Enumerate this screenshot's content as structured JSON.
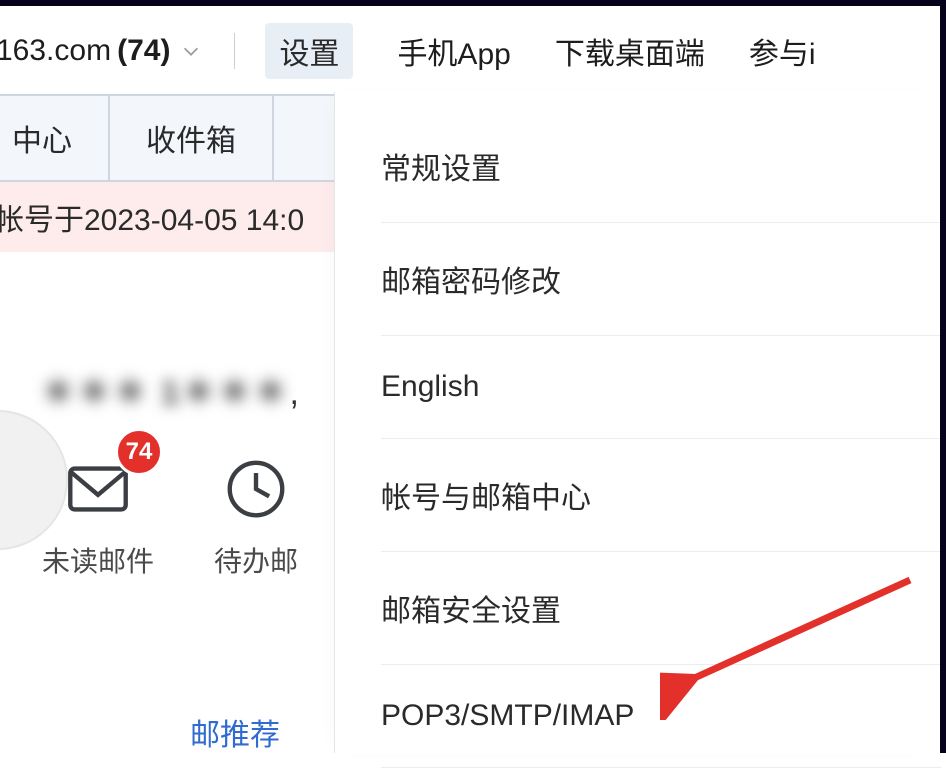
{
  "header": {
    "account_domain": "163.com",
    "unread_count": "(74)",
    "nav": {
      "settings": "设置",
      "mobile_app": "手机App",
      "download_desktop": "下载桌面端",
      "participate": "参与i"
    }
  },
  "tabs": {
    "center": "中心",
    "inbox": "收件箱"
  },
  "notice": {
    "text": "帐号于2023-04-05 14:0"
  },
  "user": {
    "masked_name": "＊＊＊  1＊＊＊",
    "suffix": ","
  },
  "quick": {
    "unread": {
      "label": "未读邮件",
      "badge": "74"
    },
    "todo": {
      "label": "待办邮"
    }
  },
  "recommend_link": "邮推荐",
  "settings_menu": {
    "general": "常规设置",
    "change_password": "邮箱密码修改",
    "english": "English",
    "account_center": "帐号与邮箱中心",
    "security": "邮箱安全设置",
    "pop3_smtp_imap": "POP3/SMTP/IMAP"
  }
}
